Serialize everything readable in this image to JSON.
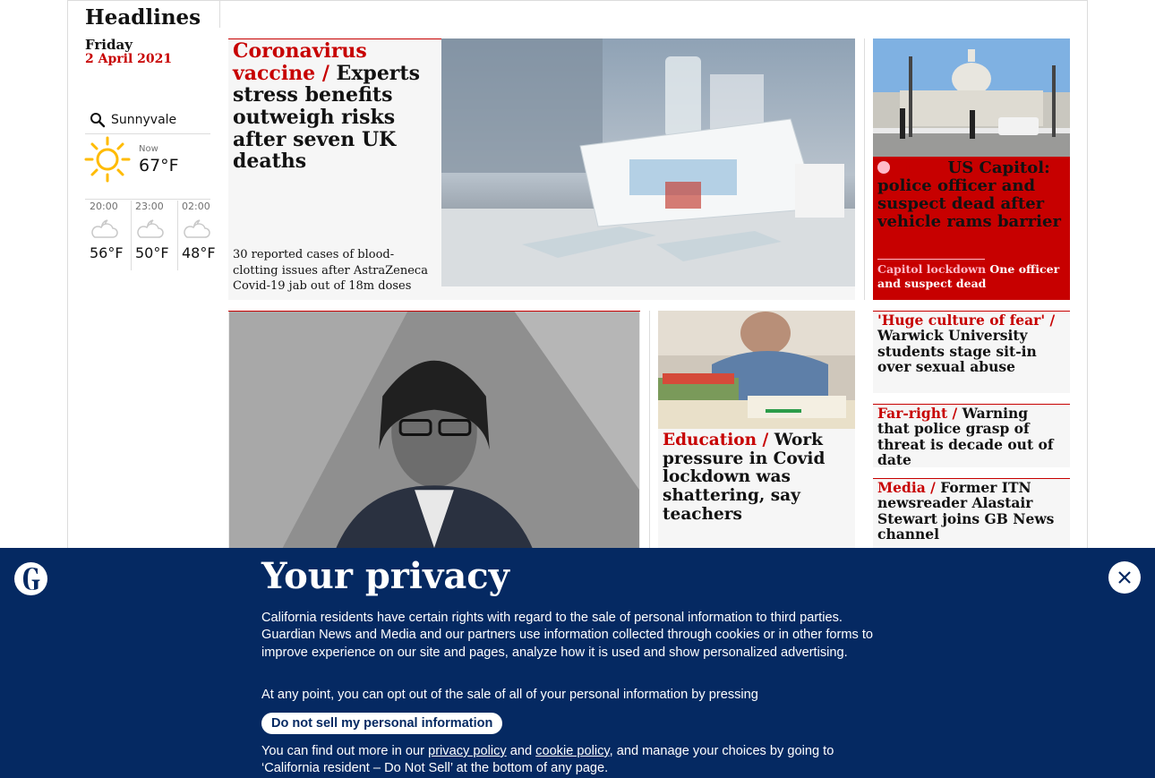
{
  "section": {
    "title": "Headlines",
    "day": "Friday",
    "date": "2 April 2021"
  },
  "weather": {
    "location": "Sunnyvale",
    "now_label": "Now",
    "now_temp": "67°F",
    "forecast": [
      {
        "time": "20:00",
        "temp": "56°F",
        "icon": "partly-cloudy-night-icon"
      },
      {
        "time": "23:00",
        "temp": "50°F",
        "icon": "partly-cloudy-night-icon"
      },
      {
        "time": "02:00",
        "temp": "48°F",
        "icon": "partly-cloudy-night-icon"
      }
    ]
  },
  "main_story": {
    "kicker": "Coronavirus vaccine /",
    "headline": "Experts stress benefits outweigh risks after seven UK deaths",
    "standfirst": "30 reported cases of blood-clotting issues after AstraZeneca Covid-19 jab out of 18m doses"
  },
  "live_story": {
    "kicker": "Live /",
    "headline": "US Capitol: police officer and suspect dead after vehicle rams barrier",
    "sub_kicker": "Capitol lockdown",
    "sub_text": "One officer and suspect dead"
  },
  "stories": [
    {
      "kicker": "'Huge culture of fear' /",
      "headline": "Warwick University students stage sit-in over sexual abuse"
    },
    {
      "kicker": "Far-right /",
      "headline": "Warning that police grasp of threat is decade out of date"
    },
    {
      "kicker": "Media /",
      "headline": "Former ITN newsreader Alastair Stewart joins GB News channel"
    }
  ],
  "education_story": {
    "kicker": "Education /",
    "headline": "Work pressure in Covid lockdown was shattering, say teachers"
  },
  "privacy": {
    "title": "Your privacy",
    "para1": "California residents have certain rights with regard to the sale of personal information to third parties. Guardian News and Media and our partners use information collected through cookies or in other forms to improve experience on our site and pages, analyze how it is used and show personalized advertising.",
    "para2": "At any point, you can opt out of the sale of all of your personal information by pressing",
    "button": "Do not sell my personal information",
    "para3_start": "You can find out more in our",
    "privacy_link": "privacy policy",
    "and": "and",
    "cookie_link": "cookie policy",
    "para3_end": ", and manage your choices by going to ‘California resident – Do Not Sell’ at the bottom of any page."
  },
  "colors": {
    "news_red": "#c70000",
    "privacy_bg": "#052962",
    "card_bg": "#f6f6f6"
  }
}
